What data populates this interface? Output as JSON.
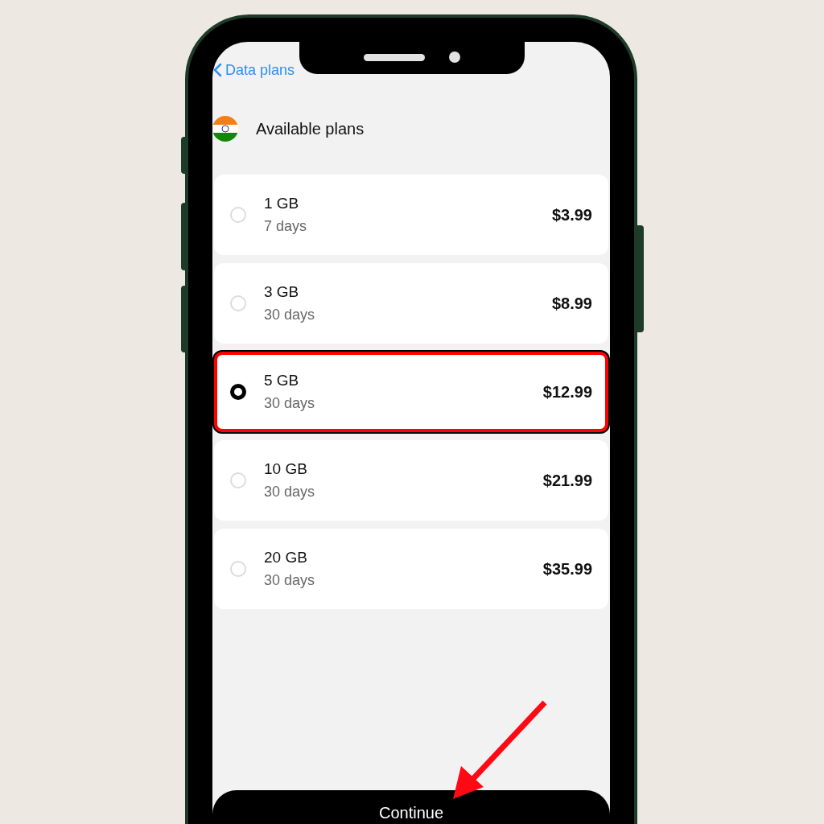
{
  "header": {
    "back_label": "Data plans"
  },
  "section": {
    "title": "Available plans"
  },
  "plans": [
    {
      "name": "1 GB",
      "duration": "7 days",
      "price": "$3.99",
      "selected": false
    },
    {
      "name": "3 GB",
      "duration": "30 days",
      "price": "$8.99",
      "selected": false
    },
    {
      "name": "5 GB",
      "duration": "30 days",
      "price": "$12.99",
      "selected": true
    },
    {
      "name": "10 GB",
      "duration": "30 days",
      "price": "$21.99",
      "selected": false
    },
    {
      "name": "20 GB",
      "duration": "30 days",
      "price": "$35.99",
      "selected": false
    }
  ],
  "continue_button": {
    "label": "Continue"
  }
}
